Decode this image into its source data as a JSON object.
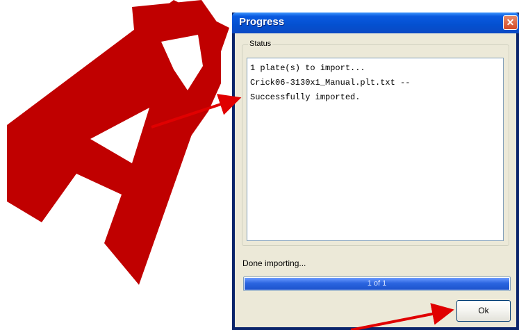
{
  "window": {
    "title": "Progress",
    "close_icon": "close-icon",
    "close_glyph": "✕"
  },
  "status_group": {
    "label": "Status",
    "lines": [
      "1 plate(s) to import...",
      "Crick06-3130x1_Manual.plt.txt --",
      "Successfully imported."
    ]
  },
  "done_text": "Done importing...",
  "progress": {
    "text": "1 of 1",
    "fraction": 1.0,
    "color": "#2b65e0"
  },
  "ok_button": {
    "label": "Ok"
  },
  "watermark": {
    "text": "AR",
    "color": "#c00000"
  },
  "annotation_arrows": {
    "color": "#e00000",
    "count": 2
  }
}
